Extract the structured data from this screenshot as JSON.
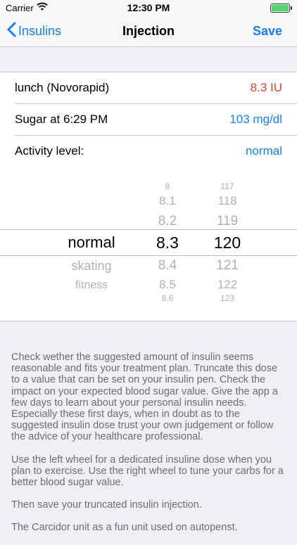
{
  "status": {
    "carrier": "Carrier",
    "time": "12:30 PM"
  },
  "nav": {
    "back_label": "Insulins",
    "title": "Injection",
    "save_label": "Save"
  },
  "rows": [
    {
      "label": "lunch (Novorapid)",
      "value": "8.3 IU"
    },
    {
      "label": "Sugar at 6:29 PM",
      "value": "103 mg/dl"
    },
    {
      "label": "Activity level:",
      "value": "normal"
    }
  ],
  "picker": {
    "activity": [
      "normal",
      "skating",
      "fitness"
    ],
    "dose": [
      "8",
      "8.1",
      "8.2",
      "8.3",
      "8.4",
      "8.5",
      "8.6"
    ],
    "carbs": [
      "117",
      "118",
      "119",
      "120",
      "121",
      "122",
      "123"
    ]
  },
  "info": [
    "Check wether the suggested amount of insulin seems reasonable and fits your treatment plan. Truncate this dose to a value that can be set on your insulin pen. Check the impact on your expected blood sugar value. Give the app a few days to learn about your personal insulin needs. Especially these first days, when in doubt as to the suggested insulin dose trust your own judgement or follow the advice of your healthcare professional.",
    "Use the left wheel for a dedicated insuline dose when you plan to exercise. Use the right wheel to tune your carbs for a better blood sugar value.",
    "Then save your truncated insulin injection.",
    "The Carcidor unit as a fun unit used on autopenst."
  ]
}
